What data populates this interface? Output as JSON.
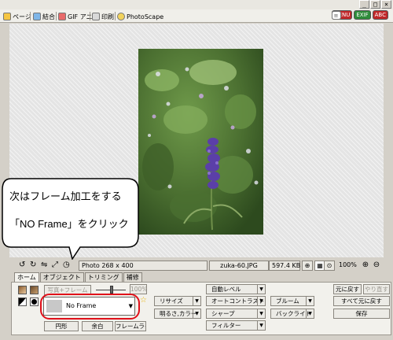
{
  "window": {
    "controls": [
      "_",
      "□",
      "×"
    ]
  },
  "tabs": [
    {
      "label": "ページ",
      "icon": "page-icon"
    },
    {
      "label": "結合",
      "icon": "combine-icon"
    },
    {
      "label": "GIF アニメ",
      "icon": "gif-animation-icon"
    },
    {
      "label": "印刷",
      "icon": "print-icon"
    },
    {
      "label": "PhotoScape",
      "icon": "photoscape-icon"
    }
  ],
  "top_icons": [
    {
      "label": "MENU",
      "color": "#c0282a"
    },
    {
      "label": "",
      "icon": "copy-icon"
    },
    {
      "label": "EXIF",
      "color": "#2e8b3a"
    },
    {
      "label": "ABC",
      "color": "#c0282a"
    },
    {
      "label": "",
      "icon": "people-icon"
    },
    {
      "label": "?",
      "icon": "help-icon"
    },
    {
      "label": "≡",
      "icon": "list-icon"
    }
  ],
  "callout": {
    "line1": "次はフレーム加工をする",
    "line2": "「NO Frame」をクリック",
    "border_color": "#000000"
  },
  "status": {
    "photo_size": "Photo 268 x 400",
    "filename": "zuka-60.JPG",
    "filesize": "597.4 KB",
    "zoom": "100%"
  },
  "property_tabs": [
    "ホーム",
    "オブジェクト",
    "トリミング",
    "補修"
  ],
  "toolbar": {
    "photo_plus_frame": "写真+フレーム",
    "opacity": "100%",
    "frame_name": "No Frame",
    "round_btn": "円形",
    "margin_btn": "余白",
    "frame_line_btn": "フレームライン",
    "resize": "リサイズ",
    "brightness_color": "明るさ,カラー",
    "auto_level": "自動レベル",
    "auto_contrast": "オートコントラスト",
    "sharpen": "シャープ",
    "filter": "フィルター",
    "bloom": "ブルーム",
    "backlight": "バックライト",
    "undo": "元に戻す",
    "redo": "やり直す",
    "undo_all": "すべて元に戻す",
    "save": "保存"
  },
  "colors": {
    "highlight_ring": "#e0101a",
    "accent_star": "#e8b400"
  }
}
